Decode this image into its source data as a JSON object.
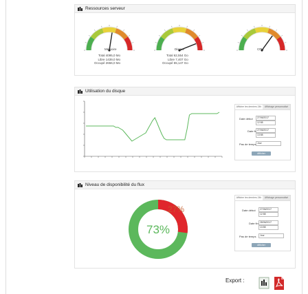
{
  "sections": {
    "resources_title": "Ressources serveur",
    "disk_title": "Utilisation du disque",
    "availability_title": "Niveau de disponibilité du flux"
  },
  "gauges": [
    {
      "label": "Mémoire",
      "value_pct": 55,
      "stats": [
        "Total 4095,0 Mo",
        "Libre 1439,0 Mo",
        "Occupé 2656,0 Mo"
      ]
    },
    {
      "label": "Disque",
      "value_pct": 88,
      "stats": [
        "Total 62,554 Go",
        "Libre 7,407 Go",
        "Occupé 55,147 Go"
      ]
    },
    {
      "label": "CPU",
      "value_pct": 70,
      "stats": []
    }
  ],
  "filter_panel": {
    "tabs": [
      "Afficher les derniers 24h",
      "Affichage personnalisé"
    ],
    "start_label": "Date début",
    "end_label": "Date fin",
    "step_label": "Pas de temps",
    "step_value": "Jour",
    "submit_label": "Afficher",
    "disk": {
      "start_date": "27/06/2017",
      "start_time": "12:58",
      "end_date": "27/06/2017",
      "end_time": "13:58"
    },
    "flux": {
      "start_date": "27/06/2017",
      "start_time": "12:58",
      "end_date": "28/06/2017",
      "end_time": "13:58"
    }
  },
  "donut": {
    "green_pct": 73,
    "red_pct": 27,
    "green_label": "73%",
    "red_label": "27%",
    "green_color": "#5cb85c",
    "red_color": "#e0262c"
  },
  "disk_series": [
    18,
    18,
    18,
    18,
    18,
    18,
    18,
    18,
    18,
    18,
    18,
    18,
    18,
    17,
    17,
    16,
    15,
    13,
    11,
    9,
    7,
    8,
    9,
    10,
    11,
    12,
    13,
    16,
    19,
    22,
    24,
    20,
    16,
    12,
    9,
    8,
    8,
    8,
    8,
    8,
    8,
    8,
    8,
    8,
    16,
    26,
    27,
    27,
    27,
    27,
    27,
    27,
    27,
    27,
    27,
    27,
    27,
    27,
    28
  ],
  "export": {
    "label": "Export :"
  }
}
